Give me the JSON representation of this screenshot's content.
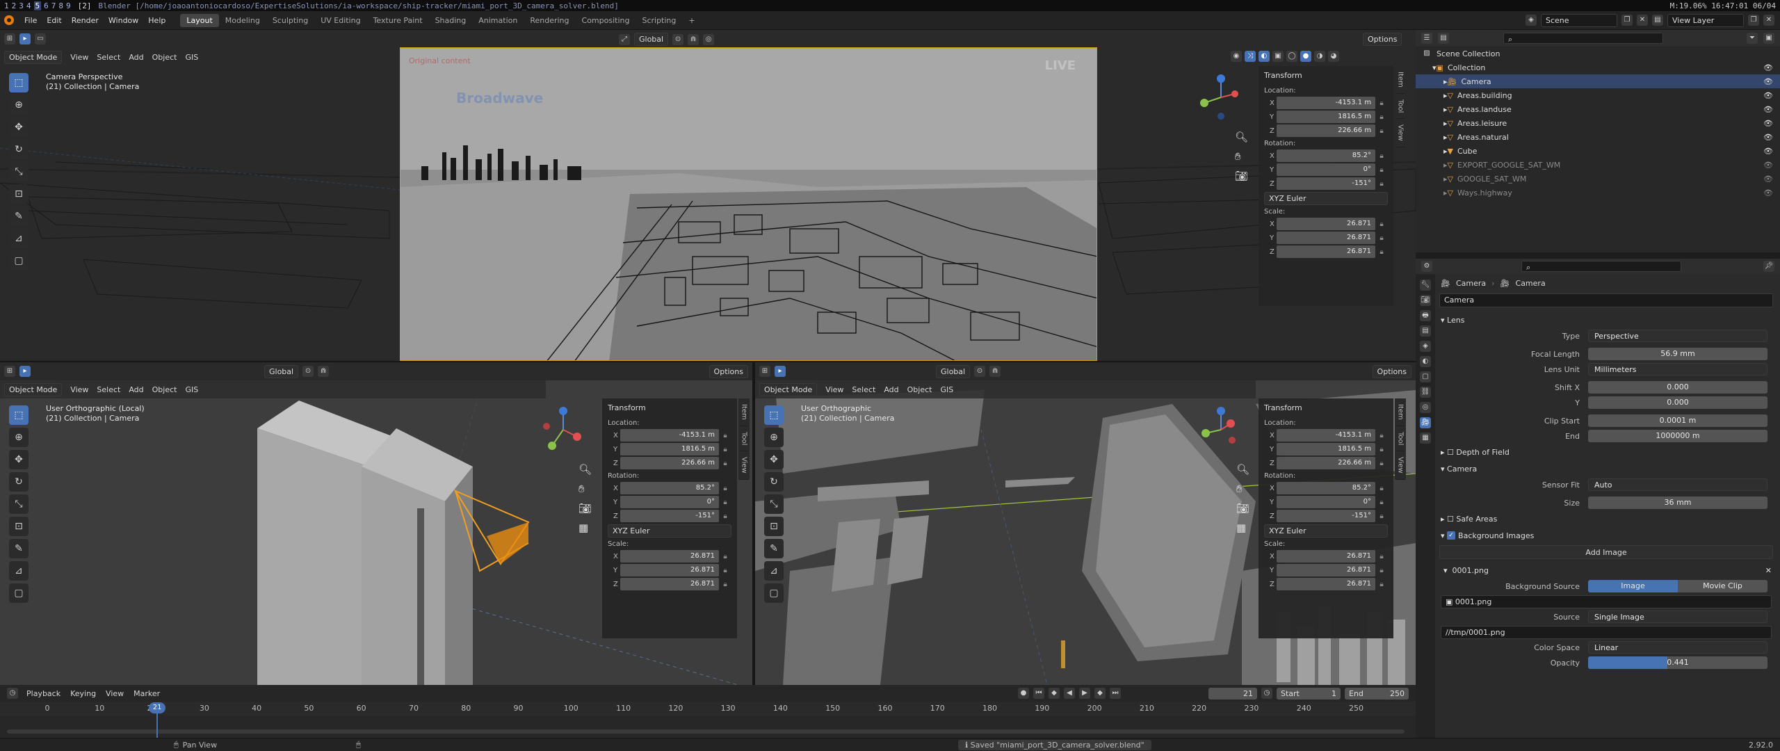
{
  "sysbar": {
    "workspaces": [
      "1",
      "2",
      "3",
      "4",
      "5",
      "6",
      "7",
      "8",
      "9"
    ],
    "active_ws": "5",
    "layout": "[2]",
    "title": "Blender [/home/joaoantoniocardoso/ExpertiseSolutions/ia-workspace/ship-tracker/miami_port_3D_camera_solver.blend]",
    "status": "M:19.06%  16:47:01  06/04"
  },
  "menu": {
    "items": [
      "File",
      "Edit",
      "Render",
      "Window",
      "Help"
    ],
    "tabs": [
      "Layout",
      "Modeling",
      "Sculpting",
      "UV Editing",
      "Texture Paint",
      "Shading",
      "Animation",
      "Rendering",
      "Compositing",
      "Scripting"
    ],
    "active_tab": "Layout",
    "add_tab": "+",
    "scene_label": "Scene",
    "view_layer": "View Layer"
  },
  "viewport_main": {
    "mode": "Object Mode",
    "menus": [
      "View",
      "Select",
      "Add",
      "Object",
      "GIS"
    ],
    "orient": "Global",
    "options": "Options",
    "title": "Camera Perspective",
    "subtitle": "(21) Collection | Camera",
    "watermark_left": "Original content",
    "watermark_brand": "Broadwave",
    "watermark_live": "LIVE"
  },
  "viewport_left": {
    "mode": "Object Mode",
    "menus": [
      "View",
      "Select",
      "Add",
      "Object",
      "GIS"
    ],
    "orient": "Global",
    "options": "Options",
    "title": "User Orthographic (Local)",
    "subtitle": "(21) Collection | Camera"
  },
  "viewport_right": {
    "mode": "Object Mode",
    "menus": [
      "View",
      "Select",
      "Add",
      "Object",
      "GIS"
    ],
    "orient": "Global",
    "options": "Options",
    "title": "User Orthographic",
    "subtitle": "(21) Collection | Camera"
  },
  "transform": {
    "header": "Transform",
    "location_label": "Location:",
    "rotation_label": "Rotation:",
    "scale_label": "Scale:",
    "location": [
      {
        "axis": "X",
        "value": "-4153.1 m"
      },
      {
        "axis": "Y",
        "value": "1816.5 m"
      },
      {
        "axis": "Z",
        "value": "226.66 m"
      }
    ],
    "rotation": [
      {
        "axis": "X",
        "value": "85.2°"
      },
      {
        "axis": "Y",
        "value": "0°"
      },
      {
        "axis": "Z",
        "value": "-151°"
      }
    ],
    "euler": "XYZ Euler",
    "scale": [
      {
        "axis": "X",
        "value": "26.871"
      },
      {
        "axis": "Y",
        "value": "26.871"
      },
      {
        "axis": "Z",
        "value": "26.871"
      }
    ],
    "tabs": [
      "Item",
      "Tool",
      "View"
    ]
  },
  "outliner": {
    "root": "Scene Collection",
    "items": [
      {
        "name": "Collection",
        "indent": 1,
        "selected": false,
        "dim": false
      },
      {
        "name": "Camera",
        "indent": 2,
        "selected": true,
        "dim": false
      },
      {
        "name": "Areas.building",
        "indent": 2,
        "selected": false,
        "dim": false
      },
      {
        "name": "Areas.landuse",
        "indent": 2,
        "selected": false,
        "dim": false
      },
      {
        "name": "Areas.leisure",
        "indent": 2,
        "selected": false,
        "dim": false
      },
      {
        "name": "Areas.natural",
        "indent": 2,
        "selected": false,
        "dim": false
      },
      {
        "name": "Cube",
        "indent": 2,
        "selected": false,
        "dim": false
      },
      {
        "name": "EXPORT_GOOGLE_SAT_WM",
        "indent": 2,
        "selected": false,
        "dim": true
      },
      {
        "name": "GOOGLE_SAT_WM",
        "indent": 2,
        "selected": false,
        "dim": true
      },
      {
        "name": "Ways.highway",
        "indent": 2,
        "selected": false,
        "dim": true
      }
    ]
  },
  "props": {
    "breadcrumb_a": "Camera",
    "breadcrumb_b": "Camera",
    "data_name": "Camera",
    "lens_section": "Lens",
    "rows_lens": [
      {
        "label": "Type",
        "value": "Perspective",
        "dropdown": true
      },
      {
        "label": "Focal Length",
        "value": "56.9 mm",
        "dropdown": false
      },
      {
        "label": "Lens Unit",
        "value": "Millimeters",
        "dropdown": true
      },
      {
        "label": "Shift X",
        "value": "0.000",
        "dropdown": false
      },
      {
        "label": "Y",
        "value": "0.000",
        "dropdown": false
      },
      {
        "label": "Clip Start",
        "value": "0.0001 m",
        "dropdown": false
      },
      {
        "label": "End",
        "value": "1000000 m",
        "dropdown": false
      }
    ],
    "dof": "Depth of Field",
    "camera_section": "Camera",
    "rows_camera": [
      {
        "label": "Sensor Fit",
        "value": "Auto",
        "dropdown": true
      },
      {
        "label": "Size",
        "value": "36 mm",
        "dropdown": false
      }
    ],
    "safe_areas": "Safe Areas",
    "bg_images": "Background Images",
    "add_image": "Add Image",
    "image_name": "0001.png",
    "bg_source_label": "Background Source",
    "bg_source_opt1": "Image",
    "bg_source_opt2": "Movie Clip",
    "image_field": "0001.png",
    "source_label": "Source",
    "source_value": "Single Image",
    "path": "//tmp/0001.png",
    "color_space_label": "Color Space",
    "color_space_value": "Linear",
    "opacity_label": "Opacity",
    "opacity_value": "0.441"
  },
  "timeline": {
    "menus": [
      "Playback",
      "Keying",
      "View",
      "Marker"
    ],
    "current_frame": "21",
    "start_label": "Start",
    "start": "1",
    "end_label": "End",
    "end": "250",
    "ticks": [
      "0",
      "10",
      "20",
      "30",
      "40",
      "50",
      "60",
      "70",
      "80",
      "90",
      "100",
      "110",
      "120",
      "130",
      "140",
      "150",
      "160",
      "170",
      "180",
      "190",
      "200",
      "210",
      "220",
      "230",
      "240",
      "250"
    ],
    "playhead": "21"
  },
  "status": {
    "hint": "Pan View",
    "message": "Saved \"miami_port_3D_camera_solver.blend\"",
    "version": "2.92.0"
  }
}
